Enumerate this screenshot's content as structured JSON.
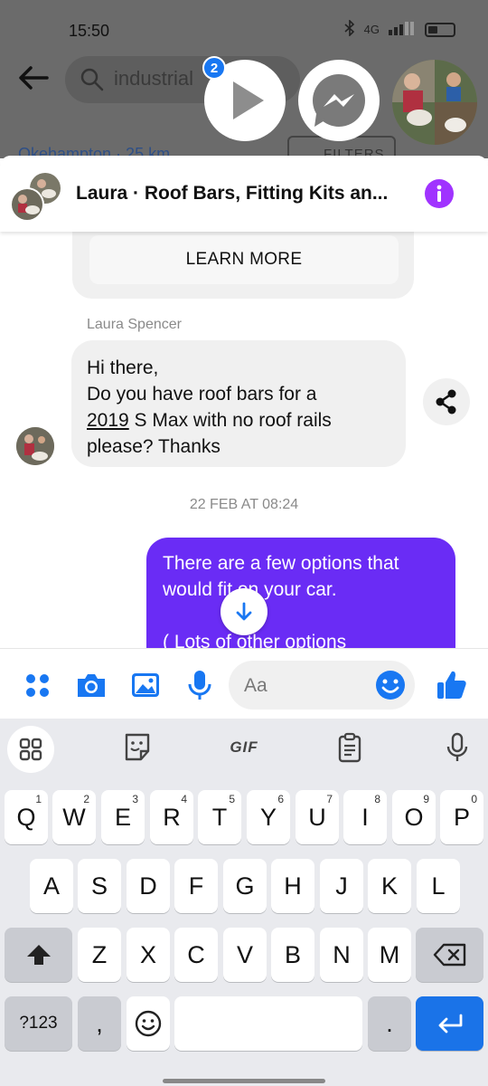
{
  "status_bar": {
    "time": "15:50",
    "network_label": "4G"
  },
  "background_page": {
    "search_text": "industrial",
    "filters_label": "FILTERS",
    "partial_text": "Okehampton · 25 km"
  },
  "chat_heads": {
    "unread_badge": "2"
  },
  "chat": {
    "title": "Laura · Roof Bars, Fitting Kits an...",
    "learn_more_label": "LEARN MORE",
    "sender_name": "Laura Spencer",
    "incoming_message": {
      "line1": "Hi there,",
      "line2": "Do you have roof bars for a",
      "year": "2019",
      "line3_rest": " S Max with no roof rails",
      "line4": "please? Thanks"
    },
    "timestamp": "22 FEB AT 08:24",
    "outgoing_message": {
      "line1": "There are a few options that",
      "line2": "would fit on your car.",
      "line3": "( Lots of other options"
    }
  },
  "composer": {
    "placeholder": "Aa"
  },
  "keyboard": {
    "toolbar": [
      "apps-icon",
      "sticker-icon",
      "GIF",
      "clipboard-icon",
      "mic-icon"
    ],
    "gif_label": "GIF",
    "row1": [
      {
        "k": "Q",
        "n": "1"
      },
      {
        "k": "W",
        "n": "2"
      },
      {
        "k": "E",
        "n": "3"
      },
      {
        "k": "R",
        "n": "4"
      },
      {
        "k": "T",
        "n": "5"
      },
      {
        "k": "Y",
        "n": "6"
      },
      {
        "k": "U",
        "n": "7"
      },
      {
        "k": "I",
        "n": "8"
      },
      {
        "k": "O",
        "n": "9"
      },
      {
        "k": "P",
        "n": "0"
      }
    ],
    "row2": [
      "A",
      "S",
      "D",
      "F",
      "G",
      "H",
      "J",
      "K",
      "L"
    ],
    "row3": [
      "Z",
      "X",
      "C",
      "V",
      "B",
      "N",
      "M"
    ],
    "symbols_label": "?123",
    "comma_label": ",",
    "period_label": "."
  },
  "colors": {
    "brand_blue": "#1877f2",
    "outgoing_bubble": "#6a2cf5",
    "info_purple": "#a033ff",
    "enter_key": "#1a73e8"
  }
}
